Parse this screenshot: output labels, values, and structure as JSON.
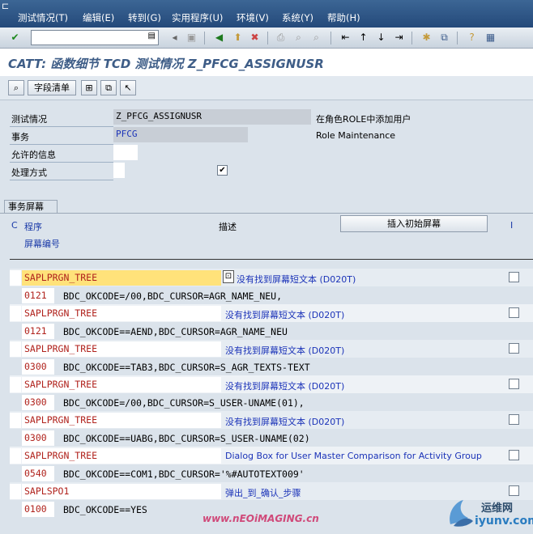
{
  "menu": [
    "测试情况(T)",
    "编辑(E)",
    "转到(G)",
    "实用程序(U)",
    "环境(V)",
    "系统(Y)",
    "帮助(H)"
  ],
  "title": "CATT: 函数细节 TCD 测试情况 Z_PFCG_ASSIGNUSR",
  "app_toolbar": {
    "field_list_label": "字段清单"
  },
  "header": {
    "test_case_label": "测试情况",
    "test_case_value": "Z_PFCG_ASSIGNUSR",
    "test_case_desc": "在角色ROLE中添加用户",
    "transaction_label": "事务",
    "transaction_value": "PFCG",
    "transaction_desc": "Role Maintenance",
    "allowed_msg_label": "允许的信息",
    "processing_mode_label": "处理方式",
    "processing_checked": true
  },
  "screens_tab": {
    "tab_label": "事务屏幕",
    "col_c": "C",
    "col_program": "程序",
    "col_screen_no": "屏幕编号",
    "col_desc": "描述",
    "insert_button": "插入初始屏幕",
    "col_i": "I",
    "rows": [
      {
        "program": "SAPLPRGN_TREE",
        "desc": "没有找到屏幕短文本 (D020T)",
        "screen": "0121",
        "okcode": "BDC_OKCODE=/00,BDC_CURSOR=AGR_NAME_NEU,"
      },
      {
        "program": "SAPLPRGN_TREE",
        "desc": "没有找到屏幕短文本 (D020T)",
        "screen": "0121",
        "okcode": "BDC_OKCODE==AEND,BDC_CURSOR=AGR_NAME_NEU"
      },
      {
        "program": "SAPLPRGN_TREE",
        "desc": "没有找到屏幕短文本 (D020T)",
        "screen": "0300",
        "okcode": "BDC_OKCODE==TAB3,BDC_CURSOR=S_AGR_TEXTS-TEXT"
      },
      {
        "program": "SAPLPRGN_TREE",
        "desc": "没有找到屏幕短文本 (D020T)",
        "screen": "0300",
        "okcode": "BDC_OKCODE=/00,BDC_CURSOR=S_USER-UNAME(01),"
      },
      {
        "program": "SAPLPRGN_TREE",
        "desc": "没有找到屏幕短文本 (D020T)",
        "screen": "0300",
        "okcode": "BDC_OKCODE==UABG,BDC_CURSOR=S_USER-UNAME(02)"
      },
      {
        "program": "SAPLPRGN_TREE",
        "desc": "Dialog Box for User Master Comparison for Activity Group",
        "screen": "0540",
        "okcode": "BDC_OKCODE==COM1,BDC_CURSOR='%#AUTOTEXT009'"
      },
      {
        "program": "SAPLSPO1",
        "desc": "弹出_到_确认_步骤",
        "screen": "0100",
        "okcode": "BDC_OKCODE==YES"
      }
    ]
  },
  "watermarks": {
    "left": "www.nEOiMAGING.cn",
    "right_top": "运维网",
    "right_bottom": "iyunv.com"
  },
  "colors": {
    "menubar": "#2f5a8a",
    "program_text": "#b0221c",
    "desc_text": "#1b33b8",
    "highlight": "#ffe27a"
  }
}
